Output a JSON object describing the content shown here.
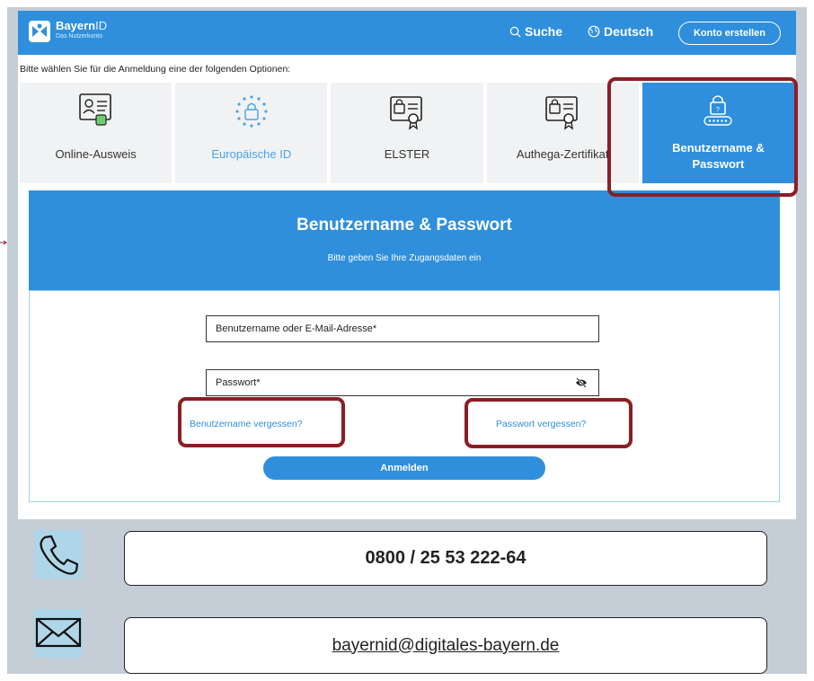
{
  "header": {
    "brand_main": "Bayern",
    "brand_id": "ID",
    "brand_sub": "Das Nutzerkonto",
    "search_label": "Suche",
    "language_label": "Deutsch",
    "create_account_label": "Konto erstellen"
  },
  "instruction": "Bitte wählen Sie für die Anmeldung eine der folgenden Optionen:",
  "login_options": [
    {
      "label": "Online-Ausweis",
      "icon": "id-card-icon"
    },
    {
      "label": "Europäische ID",
      "icon": "eu-lock-icon"
    },
    {
      "label": "ELSTER",
      "icon": "certificate-icon"
    },
    {
      "label": "Authega-Zertifikat",
      "icon": "certificate-icon"
    },
    {
      "label_line1": "Benutzername &",
      "label_line2": "Passwort",
      "icon": "password-lock-icon",
      "selected": true
    }
  ],
  "form": {
    "title": "Benutzername & Passwort",
    "subtitle": "Bitte geben Sie Ihre Zugangsdaten ein",
    "username_placeholder": "Benutzername oder E-Mail-Adresse*",
    "password_placeholder": "Passwort*",
    "forgot_username": "Benutzername vergessen?",
    "forgot_password": "Passwort vergessen?",
    "login_button": "Anmelden"
  },
  "contact": {
    "phone": "0800 / 25 53 222-64",
    "email": "bayernid@digitales-bayern.de"
  },
  "colors": {
    "brand_blue": "#2f8fdc",
    "highlight": "#8b1e24",
    "frame": "#c5cdd6",
    "icon_bg": "#aed6e8"
  }
}
